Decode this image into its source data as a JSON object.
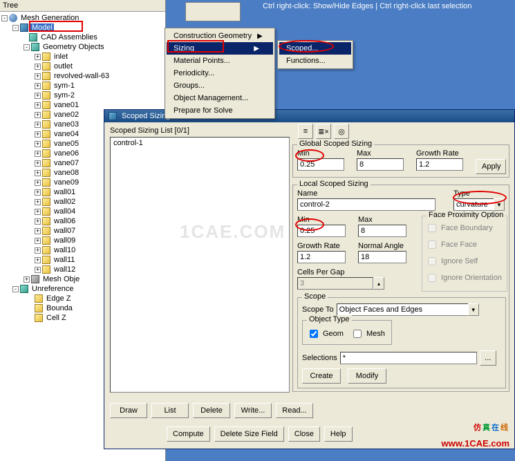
{
  "hint": "Ctrl right-click: Show/Hide Edges | Ctrl right-click last selection",
  "tree": {
    "header": "Tree",
    "root": "Mesh Generation",
    "model": "Model",
    "cad": "CAD Assemblies",
    "geom": "Geometry Objects",
    "items": [
      "inlet",
      "outlet",
      "revolved-wall-63",
      "sym-1",
      "sym-2",
      "vane01",
      "vane02",
      "vane03",
      "vane04",
      "vane05",
      "vane06",
      "vane07",
      "vane08",
      "vane09",
      "wall01",
      "wall02",
      "wall04",
      "wall06",
      "wall07",
      "wall09",
      "wall10",
      "wall11",
      "wall12"
    ],
    "mesh_obj": "Mesh Obje",
    "unref": "Unreference",
    "unref_items": [
      "Edge Z",
      "Bounda",
      "Cell Z"
    ]
  },
  "menu1": {
    "items": [
      "Construction Geometry",
      "Sizing",
      "Material Points...",
      "Periodicity...",
      "Groups...",
      "Object Management...",
      "Prepare for Solve"
    ]
  },
  "menu2": {
    "scoped": "Scoped...",
    "functions": "Functions..."
  },
  "dialog": {
    "title": "Scoped Sizing",
    "list_label": "Scoped Sizing List [0/1]",
    "list_item": "control-1",
    "global": {
      "legend": "Global Scoped Sizing",
      "min_lbl": "Min",
      "min": "0.25",
      "max_lbl": "Max",
      "max": "8",
      "gr_lbl": "Growth Rate",
      "gr": "1.2",
      "apply": "Apply"
    },
    "local": {
      "legend": "Local Scoped Sizing",
      "name_lbl": "Name",
      "name": "control-2",
      "type_lbl": "Type",
      "type": "curvature",
      "min_lbl": "Min",
      "min": "0.25",
      "max_lbl": "Max",
      "max": "8",
      "gr_lbl": "Growth Rate",
      "gr": "1.2",
      "na_lbl": "Normal Angle",
      "na": "18",
      "cpg_lbl": "Cells Per Gap",
      "cpg": "3",
      "fpo_legend": "Face Proximity Option",
      "fpo": [
        "Face Boundary",
        "Face Face",
        "Ignore Self",
        "Ignore Orientation"
      ]
    },
    "scope": {
      "legend": "Scope",
      "scope_to_lbl": "Scope To",
      "scope_to": "Object Faces and Edges",
      "obj_type": "Object Type",
      "geom": "Geom",
      "mesh": "Mesh",
      "sel_lbl": "Selections",
      "sel": "*",
      "create": "Create",
      "modify": "Modify"
    },
    "row1": [
      "Draw",
      "List",
      "Delete",
      "Write...",
      "Read..."
    ],
    "row2": [
      "Compute",
      "Delete Size Field",
      "Close",
      "Help"
    ]
  },
  "brand1": "仿真在线",
  "brand2": "www.1CAE.com",
  "watermark": "1CAE.COM"
}
